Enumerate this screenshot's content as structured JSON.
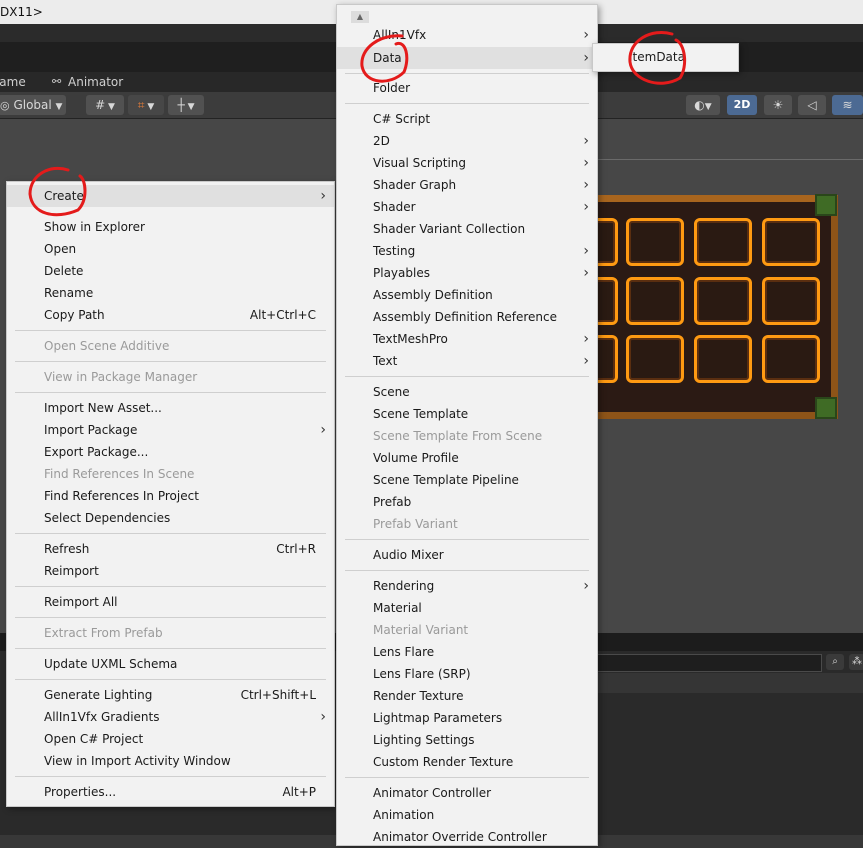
{
  "window": {
    "title": "DX11>"
  },
  "tabs": [
    {
      "label": "Game"
    },
    {
      "label": "Animator"
    }
  ],
  "scene_toolbar": {
    "global_label": "Global",
    "mode_2d": "2D"
  },
  "context_menu": {
    "items": [
      {
        "label": "Create",
        "submenu": true,
        "highlighted": true
      },
      {
        "label": "Show in Explorer"
      },
      {
        "label": "Open"
      },
      {
        "label": "Delete"
      },
      {
        "label": "Rename"
      },
      {
        "label": "Copy Path",
        "shortcut": "Alt+Ctrl+C"
      },
      {
        "label": "Open Scene Additive",
        "disabled": true
      },
      {
        "label": "View in Package Manager",
        "disabled": true
      },
      {
        "label": "Import New Asset..."
      },
      {
        "label": "Import Package",
        "submenu": true
      },
      {
        "label": "Export Package..."
      },
      {
        "label": "Find References In Scene",
        "disabled": true
      },
      {
        "label": "Find References In Project"
      },
      {
        "label": "Select Dependencies"
      },
      {
        "label": "Refresh",
        "shortcut": "Ctrl+R"
      },
      {
        "label": "Reimport"
      },
      {
        "label": "Reimport All"
      },
      {
        "label": "Extract From Prefab",
        "disabled": true
      },
      {
        "label": "Update UXML Schema"
      },
      {
        "label": "Generate Lighting",
        "shortcut": "Ctrl+Shift+L"
      },
      {
        "label": "AllIn1Vfx Gradients",
        "submenu": true
      },
      {
        "label": "Open C# Project"
      },
      {
        "label": "View in Import Activity Window"
      },
      {
        "label": "Properties...",
        "shortcut": "Alt+P"
      }
    ]
  },
  "create_menu": {
    "items": [
      {
        "label": "AllIn1Vfx",
        "submenu": true
      },
      {
        "label": "Data",
        "submenu": true,
        "highlighted": true
      },
      {
        "label": "Folder"
      },
      {
        "label": "C# Script"
      },
      {
        "label": "2D",
        "submenu": true
      },
      {
        "label": "Visual Scripting",
        "submenu": true
      },
      {
        "label": "Shader Graph",
        "submenu": true
      },
      {
        "label": "Shader",
        "submenu": true
      },
      {
        "label": "Shader Variant Collection"
      },
      {
        "label": "Testing",
        "submenu": true
      },
      {
        "label": "Playables",
        "submenu": true
      },
      {
        "label": "Assembly Definition"
      },
      {
        "label": "Assembly Definition Reference"
      },
      {
        "label": "TextMeshPro",
        "submenu": true
      },
      {
        "label": "Text",
        "submenu": true
      },
      {
        "label": "Scene"
      },
      {
        "label": "Scene Template"
      },
      {
        "label": "Scene Template From Scene",
        "disabled": true
      },
      {
        "label": "Volume Profile"
      },
      {
        "label": "Scene Template Pipeline"
      },
      {
        "label": "Prefab"
      },
      {
        "label": "Prefab Variant",
        "disabled": true
      },
      {
        "label": "Audio Mixer"
      },
      {
        "label": "Rendering",
        "submenu": true
      },
      {
        "label": "Material"
      },
      {
        "label": "Material Variant",
        "disabled": true
      },
      {
        "label": "Lens Flare"
      },
      {
        "label": "Lens Flare (SRP)"
      },
      {
        "label": "Render Texture"
      },
      {
        "label": "Lightmap Parameters"
      },
      {
        "label": "Lighting Settings"
      },
      {
        "label": "Custom Render Texture"
      },
      {
        "label": "Animator Controller"
      },
      {
        "label": "Animation"
      },
      {
        "label": "Animator Override Controller"
      }
    ]
  },
  "data_menu": {
    "items": [
      {
        "label": "ItemData"
      }
    ]
  },
  "colors": {
    "annotation": "#e41b1b",
    "slot_border": "#ff9a12",
    "frame_wood": "#a8651e"
  }
}
